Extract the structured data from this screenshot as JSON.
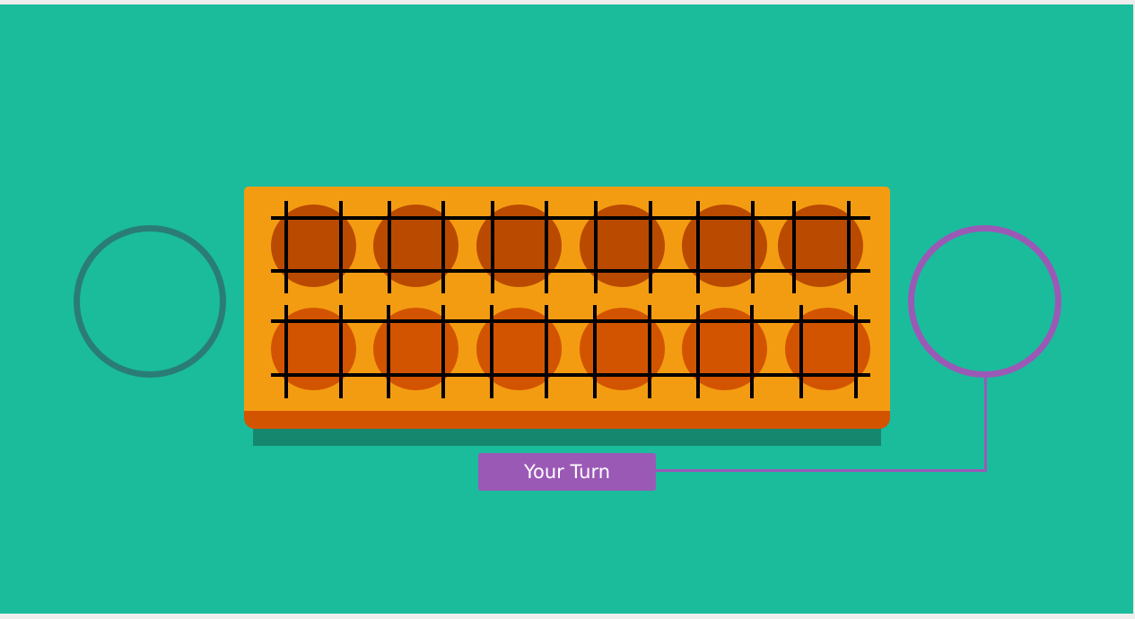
{
  "turn": {
    "label": "Your Turn"
  },
  "colors": {
    "background": "#1abc9c",
    "board": "#f39c12",
    "board_base": "#d35400",
    "pit_top": "#ba4a00",
    "pit_bottom": "#d35400",
    "opponent_store": "#2a7d77",
    "player_store": "#9b59b6",
    "turn_badge": "#9b59b6"
  },
  "board": {
    "rows": 2,
    "pits_per_row": 6,
    "top_row": [
      "",
      "",
      "",
      "",
      "",
      ""
    ],
    "bottom_row": [
      "",
      "",
      "",
      "",
      "",
      ""
    ]
  },
  "stores": {
    "opponent": "",
    "player": ""
  }
}
